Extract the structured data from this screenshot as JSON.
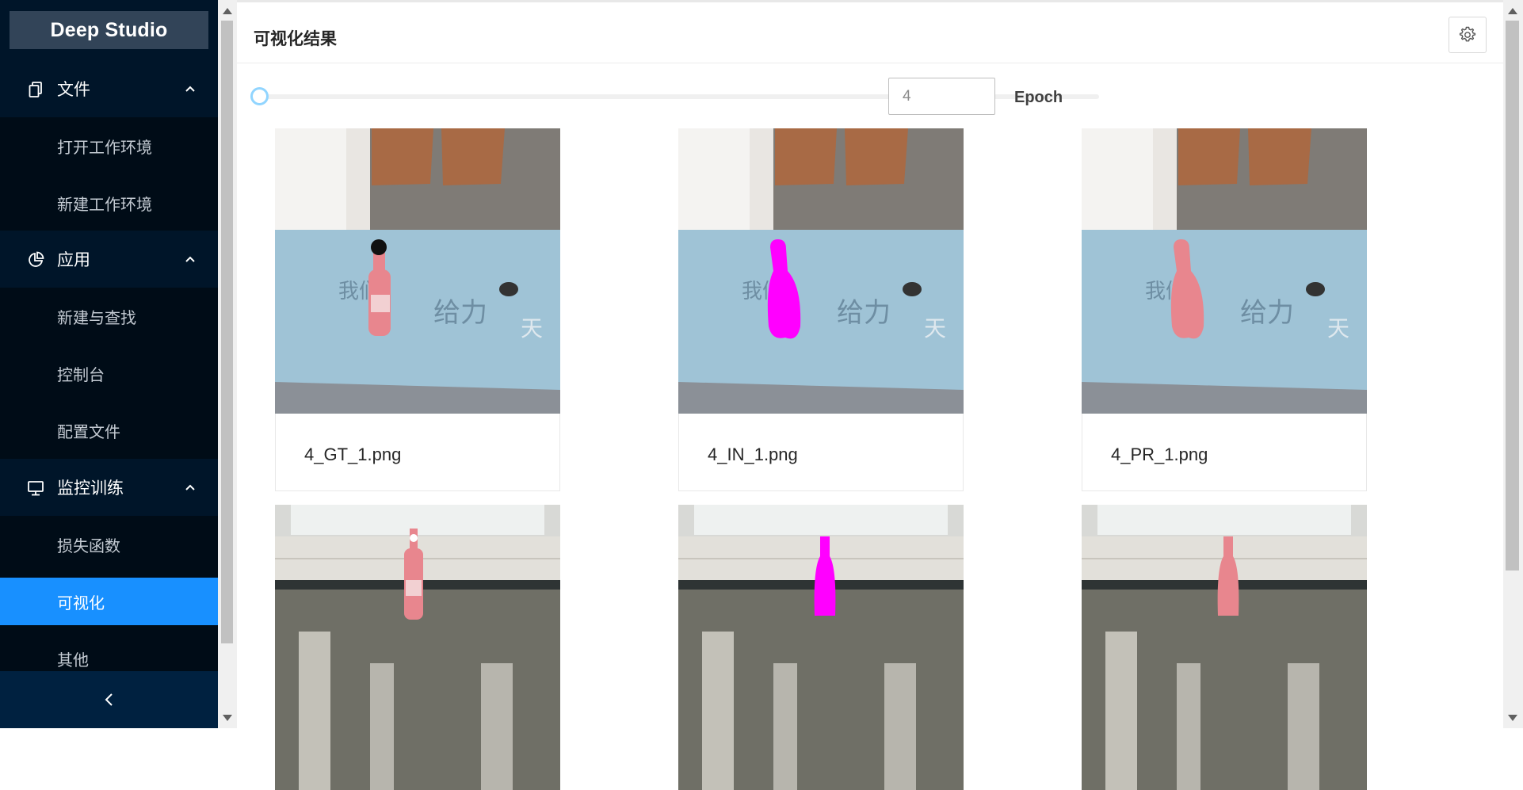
{
  "app": {
    "title": "Deep Studio"
  },
  "sidebar": {
    "groups": [
      {
        "label": "文件",
        "icon": "file-copy-icon",
        "items": [
          {
            "label": "打开工作环境"
          },
          {
            "label": "新建工作环境"
          }
        ]
      },
      {
        "label": "应用",
        "icon": "pie-chart-icon",
        "items": [
          {
            "label": "新建与查找"
          },
          {
            "label": "控制台"
          },
          {
            "label": "配置文件"
          }
        ]
      },
      {
        "label": "监控训练",
        "icon": "monitor-icon",
        "items": [
          {
            "label": "损失函数"
          },
          {
            "label": "可视化",
            "active": true
          },
          {
            "label": "其他"
          }
        ]
      }
    ],
    "collapse_icon": "chevron-left-icon"
  },
  "main": {
    "title": "可视化结果",
    "settings_icon": "gear-icon",
    "slider": {
      "value_fraction": 0
    },
    "epoch_input": {
      "value": "4"
    },
    "epoch_label": "Epoch",
    "images": [
      {
        "caption": "4_GT_1.png"
      },
      {
        "caption": "4_IN_1.png"
      },
      {
        "caption": "4_PR_1.png"
      },
      {
        "caption": ""
      },
      {
        "caption": ""
      },
      {
        "caption": ""
      }
    ]
  },
  "colors": {
    "sidebar_bg": "#001529",
    "submenu_bg": "#000c17",
    "active_item": "#1890ff",
    "mask_magenta": "#ff00ff",
    "bottle_pink": "#e8868e"
  }
}
